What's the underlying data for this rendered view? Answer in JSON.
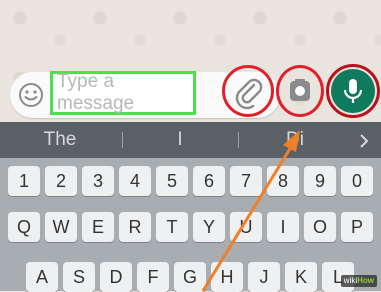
{
  "composer": {
    "placeholder": "Type a message",
    "icons": [
      "emoji-icon",
      "paperclip-icon",
      "camera-icon",
      "microphone-icon"
    ],
    "mic_color": "#008069",
    "highlight_color": "#4ce04c",
    "annotation_color": "#e0202a"
  },
  "suggestions": [
    "The",
    "I",
    "Di"
  ],
  "keyboard": {
    "numbers": [
      "1",
      "2",
      "3",
      "4",
      "5",
      "6",
      "7",
      "8",
      "9",
      "0"
    ],
    "row_q": [
      "Q",
      "W",
      "E",
      "R",
      "T",
      "Y",
      "U",
      "I",
      "O",
      "P"
    ],
    "row_a": [
      "A",
      "S",
      "D",
      "F",
      "G",
      "H",
      "J",
      "K",
      "L"
    ]
  },
  "watermark": {
    "prefix": "wiki",
    "brand": "How"
  }
}
